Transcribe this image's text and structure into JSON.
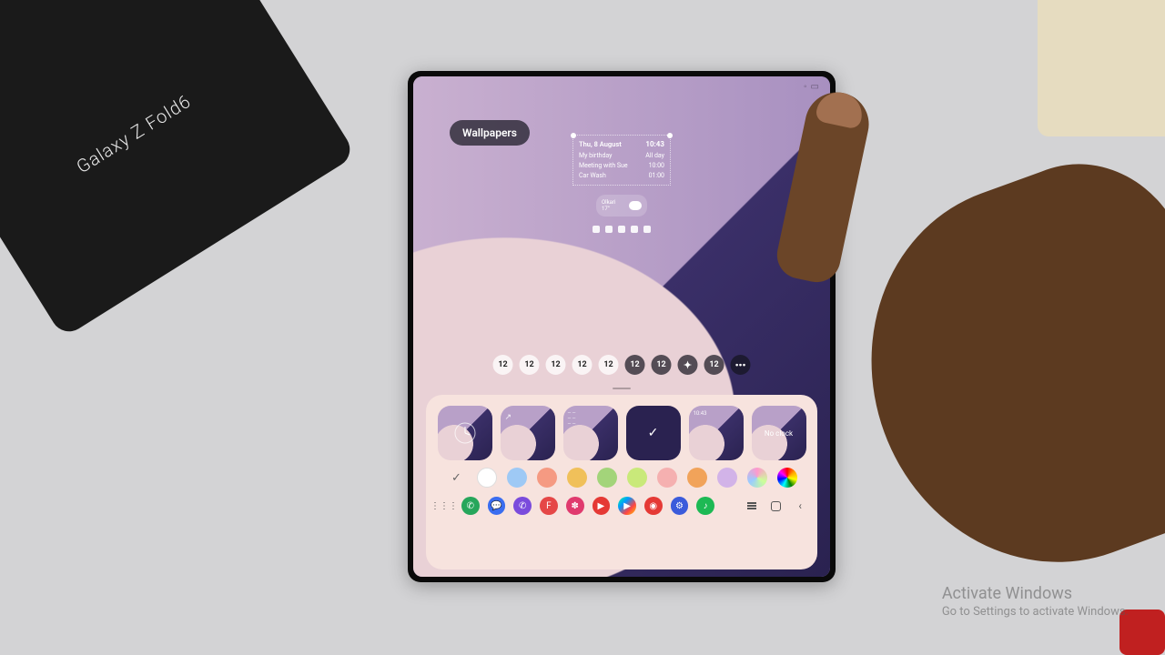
{
  "desk": {
    "box_text": "Galaxy Z Fold6"
  },
  "header": {
    "wallpapers_label": "Wallpapers"
  },
  "calendar_widget": {
    "date": "Thu, 8 August",
    "time": "10:43",
    "events": [
      {
        "title": "My birthday",
        "time": "All day"
      },
      {
        "title": "Meeting with Sue",
        "time": "10:00"
      },
      {
        "title": "Car Wash",
        "time": "01:00"
      }
    ]
  },
  "weather": {
    "city": "Olkari",
    "temp": "17°"
  },
  "clock_styles": [
    "12",
    "12",
    "12",
    "12",
    "12",
    "12",
    "12",
    "✦",
    "12",
    "•••"
  ],
  "templates": {
    "items": [
      {
        "id": "clock",
        "hint": ""
      },
      {
        "id": "arrow",
        "hint": ""
      },
      {
        "id": "calendar",
        "hint": ""
      },
      {
        "id": "selected",
        "hint": ""
      },
      {
        "id": "text",
        "hint": "10:43"
      },
      {
        "id": "noclock",
        "hint": "No clock"
      }
    ]
  },
  "colors": [
    "#ffffff",
    "#9ec9f5",
    "#f59a82",
    "#f0c05a",
    "#a3d47a",
    "#c9e97a",
    "#f5b0b0",
    "#f1a35a",
    "#d2b3e8",
    "conic-gradient(#f26, #f93, #fe0, #6c4, #0cf, #73f, #f26)",
    "conic-gradient(red, orange, yellow, green, cyan, blue, magenta, red)"
  ],
  "dock": {
    "apps": [
      "apps",
      "phone",
      "chat",
      "viber",
      "flipboard",
      "galaxy",
      "youtube",
      "play",
      "ytmusic",
      "settings",
      "spotify"
    ]
  },
  "watermark": {
    "title": "Activate Windows",
    "subtitle": "Go to Settings to activate Windows."
  }
}
